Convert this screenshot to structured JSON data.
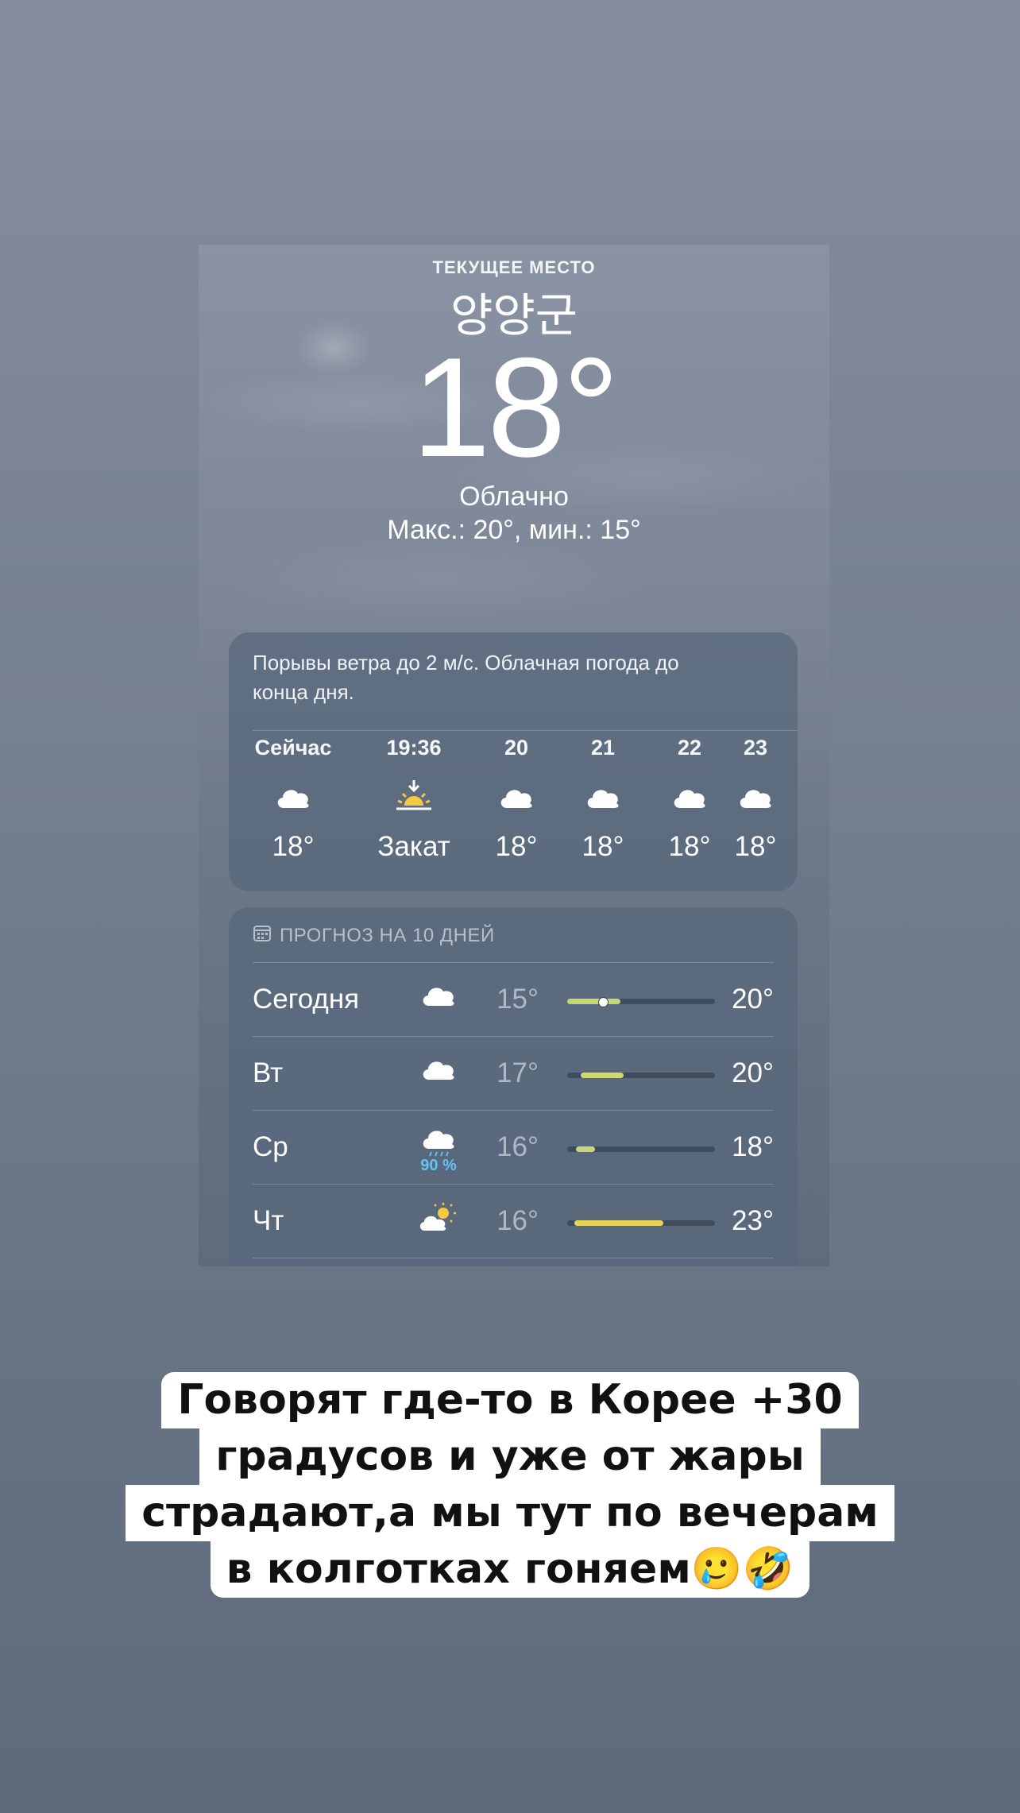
{
  "header": {
    "location_label": "ТЕКУЩЕЕ МЕСТО",
    "city": "양양군",
    "temperature": "18°",
    "condition": "Облачно",
    "range": "Макс.: 20°, мин.: 15°"
  },
  "hourly": {
    "summary": "Порывы ветра до 2 м/с. Облачная погода до конца дня.",
    "items": [
      {
        "time": "Сейчас",
        "icon": "cloud-icon",
        "temp": "18°"
      },
      {
        "time": "19:36",
        "icon": "sunset-icon",
        "temp": "Закат"
      },
      {
        "time": "20",
        "icon": "cloud-icon",
        "temp": "18°"
      },
      {
        "time": "21",
        "icon": "cloud-icon",
        "temp": "18°"
      },
      {
        "time": "22",
        "icon": "cloud-icon",
        "temp": "18°"
      },
      {
        "time": "23",
        "icon": "cloud-icon",
        "temp": "18°"
      }
    ]
  },
  "daily": {
    "title": "ПРОГНОЗ НА 10 ДНЕЙ",
    "items": [
      {
        "day": "Сегодня",
        "icon": "cloud-icon",
        "precip": "",
        "low": "15°",
        "high": "20°",
        "bar_start": 0.0,
        "bar_end": 0.36,
        "current": 0.24,
        "bar_color": "#c6d873"
      },
      {
        "day": "Вт",
        "icon": "cloud-icon",
        "precip": "",
        "low": "17°",
        "high": "20°",
        "bar_start": 0.09,
        "bar_end": 0.38,
        "current": null,
        "bar_color": "#d0d77a"
      },
      {
        "day": "Ср",
        "icon": "cloud-rain-icon",
        "precip": "90 %",
        "low": "16°",
        "high": "18°",
        "bar_start": 0.06,
        "bar_end": 0.19,
        "current": null,
        "bar_color": "#c9d57a"
      },
      {
        "day": "Чт",
        "icon": "partly-sunny-icon",
        "precip": "",
        "low": "16°",
        "high": "23°",
        "bar_start": 0.05,
        "bar_end": 0.65,
        "current": null,
        "bar_color": "#e6d35a"
      }
    ]
  },
  "caption": {
    "lines": [
      "Говорят где-то в Корее +30",
      "градусов и уже от жары",
      "страдают,а мы тут по вечерам",
      "в колготках гоняем🥲🤣"
    ]
  }
}
